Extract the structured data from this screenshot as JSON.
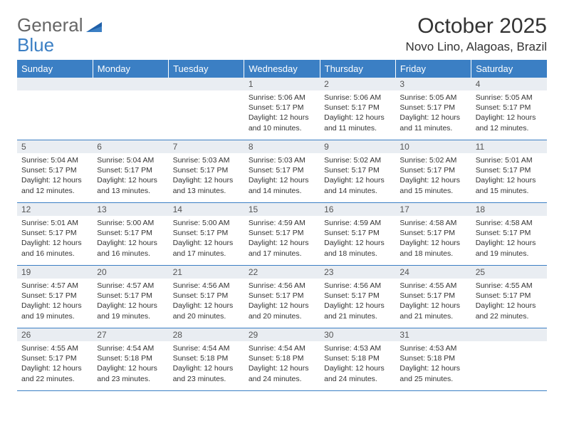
{
  "logo": {
    "text1": "General",
    "text2": "Blue"
  },
  "title": "October 2025",
  "location": "Novo Lino, Alagoas, Brazil",
  "weekdays": [
    "Sunday",
    "Monday",
    "Tuesday",
    "Wednesday",
    "Thursday",
    "Friday",
    "Saturday"
  ],
  "weeks": [
    {
      "nums": [
        "",
        "",
        "",
        "1",
        "2",
        "3",
        "4"
      ],
      "details": [
        "",
        "",
        "",
        "Sunrise: 5:06 AM\nSunset: 5:17 PM\nDaylight: 12 hours and 10 minutes.",
        "Sunrise: 5:06 AM\nSunset: 5:17 PM\nDaylight: 12 hours and 11 minutes.",
        "Sunrise: 5:05 AM\nSunset: 5:17 PM\nDaylight: 12 hours and 11 minutes.",
        "Sunrise: 5:05 AM\nSunset: 5:17 PM\nDaylight: 12 hours and 12 minutes."
      ]
    },
    {
      "nums": [
        "5",
        "6",
        "7",
        "8",
        "9",
        "10",
        "11"
      ],
      "details": [
        "Sunrise: 5:04 AM\nSunset: 5:17 PM\nDaylight: 12 hours and 12 minutes.",
        "Sunrise: 5:04 AM\nSunset: 5:17 PM\nDaylight: 12 hours and 13 minutes.",
        "Sunrise: 5:03 AM\nSunset: 5:17 PM\nDaylight: 12 hours and 13 minutes.",
        "Sunrise: 5:03 AM\nSunset: 5:17 PM\nDaylight: 12 hours and 14 minutes.",
        "Sunrise: 5:02 AM\nSunset: 5:17 PM\nDaylight: 12 hours and 14 minutes.",
        "Sunrise: 5:02 AM\nSunset: 5:17 PM\nDaylight: 12 hours and 15 minutes.",
        "Sunrise: 5:01 AM\nSunset: 5:17 PM\nDaylight: 12 hours and 15 minutes."
      ]
    },
    {
      "nums": [
        "12",
        "13",
        "14",
        "15",
        "16",
        "17",
        "18"
      ],
      "details": [
        "Sunrise: 5:01 AM\nSunset: 5:17 PM\nDaylight: 12 hours and 16 minutes.",
        "Sunrise: 5:00 AM\nSunset: 5:17 PM\nDaylight: 12 hours and 16 minutes.",
        "Sunrise: 5:00 AM\nSunset: 5:17 PM\nDaylight: 12 hours and 17 minutes.",
        "Sunrise: 4:59 AM\nSunset: 5:17 PM\nDaylight: 12 hours and 17 minutes.",
        "Sunrise: 4:59 AM\nSunset: 5:17 PM\nDaylight: 12 hours and 18 minutes.",
        "Sunrise: 4:58 AM\nSunset: 5:17 PM\nDaylight: 12 hours and 18 minutes.",
        "Sunrise: 4:58 AM\nSunset: 5:17 PM\nDaylight: 12 hours and 19 minutes."
      ]
    },
    {
      "nums": [
        "19",
        "20",
        "21",
        "22",
        "23",
        "24",
        "25"
      ],
      "details": [
        "Sunrise: 4:57 AM\nSunset: 5:17 PM\nDaylight: 12 hours and 19 minutes.",
        "Sunrise: 4:57 AM\nSunset: 5:17 PM\nDaylight: 12 hours and 19 minutes.",
        "Sunrise: 4:56 AM\nSunset: 5:17 PM\nDaylight: 12 hours and 20 minutes.",
        "Sunrise: 4:56 AM\nSunset: 5:17 PM\nDaylight: 12 hours and 20 minutes.",
        "Sunrise: 4:56 AM\nSunset: 5:17 PM\nDaylight: 12 hours and 21 minutes.",
        "Sunrise: 4:55 AM\nSunset: 5:17 PM\nDaylight: 12 hours and 21 minutes.",
        "Sunrise: 4:55 AM\nSunset: 5:17 PM\nDaylight: 12 hours and 22 minutes."
      ]
    },
    {
      "nums": [
        "26",
        "27",
        "28",
        "29",
        "30",
        "31",
        ""
      ],
      "details": [
        "Sunrise: 4:55 AM\nSunset: 5:17 PM\nDaylight: 12 hours and 22 minutes.",
        "Sunrise: 4:54 AM\nSunset: 5:18 PM\nDaylight: 12 hours and 23 minutes.",
        "Sunrise: 4:54 AM\nSunset: 5:18 PM\nDaylight: 12 hours and 23 minutes.",
        "Sunrise: 4:54 AM\nSunset: 5:18 PM\nDaylight: 12 hours and 24 minutes.",
        "Sunrise: 4:53 AM\nSunset: 5:18 PM\nDaylight: 12 hours and 24 minutes.",
        "Sunrise: 4:53 AM\nSunset: 5:18 PM\nDaylight: 12 hours and 25 minutes.",
        ""
      ]
    }
  ]
}
